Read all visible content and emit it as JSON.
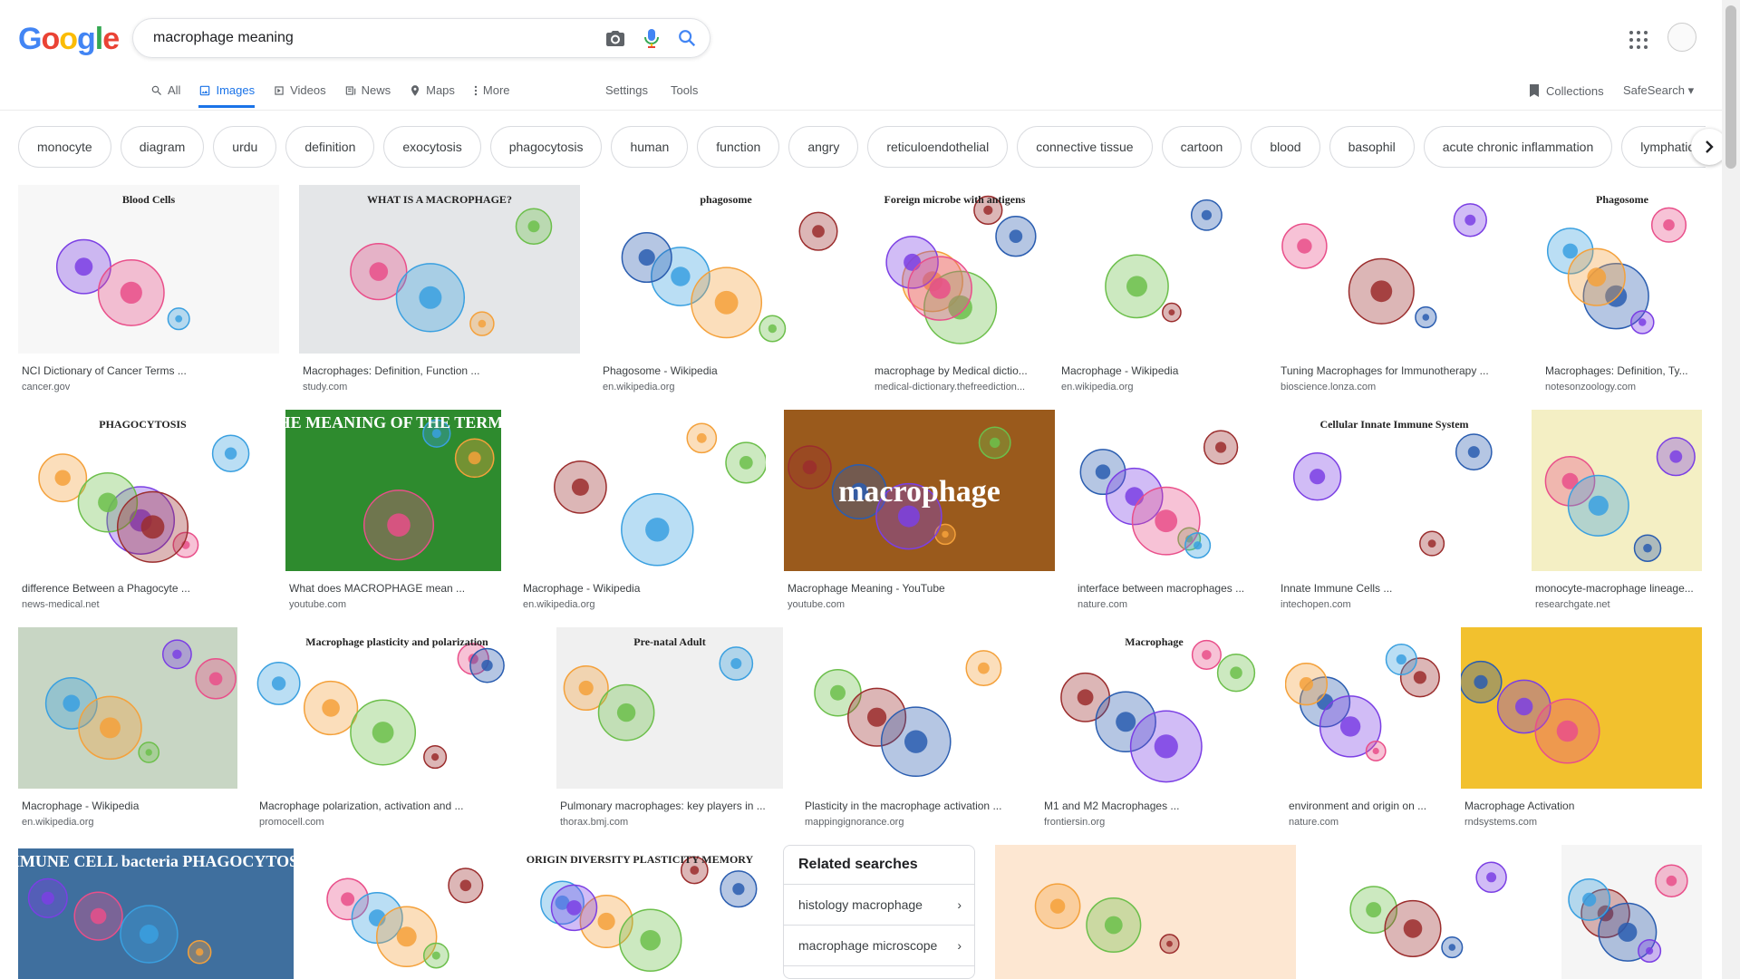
{
  "logo": [
    "G",
    "o",
    "o",
    "g",
    "l",
    "e"
  ],
  "search": {
    "query": "macrophage meaning"
  },
  "tabs": [
    {
      "label": "All",
      "icon": "search-icon"
    },
    {
      "label": "Images",
      "icon": "image-icon",
      "active": true
    },
    {
      "label": "Videos",
      "icon": "video-icon"
    },
    {
      "label": "News",
      "icon": "news-icon"
    },
    {
      "label": "Maps",
      "icon": "map-icon"
    },
    {
      "label": "More",
      "icon": "more-vert-icon"
    }
  ],
  "toolbar": {
    "settings": "Settings",
    "tools": "Tools",
    "collections": "Collections",
    "safesearch": "SafeSearch"
  },
  "chips": [
    "monocyte",
    "diagram",
    "urdu",
    "definition",
    "exocytosis",
    "phagocytosis",
    "human",
    "function",
    "angry",
    "reticuloendothelial",
    "connective tissue",
    "cartoon",
    "blood",
    "basophil",
    "acute chronic inflammation",
    "lymphatic sys"
  ],
  "results": [
    {
      "title": "NCI Dictionary of Cancer Terms ...",
      "source": "cancer.gov",
      "thumb_text": "Blood Cells",
      "color": "#f7f7f7"
    },
    {
      "title": "Macrophages: Definition, Function ...",
      "source": "study.com",
      "thumb_text": "WHAT IS A MACROPHAGE?",
      "color": "#e4e6e8"
    },
    {
      "title": "Phagosome - Wikipedia",
      "source": "en.wikipedia.org",
      "thumb_text": "phagosome",
      "color": "#ffffff"
    },
    {
      "title": "macrophage by Medical dictio...",
      "source": "medical-dictionary.thefreediction...",
      "thumb_text": "Foreign microbe with antigens",
      "color": "#ffffff"
    },
    {
      "title": "Macrophage - Wikipedia",
      "source": "en.wikipedia.org",
      "thumb_text": "",
      "color": "#ffffff"
    },
    {
      "title": "Tuning Macrophages for Immunotherapy ...",
      "source": "bioscience.lonza.com",
      "thumb_text": "",
      "color": "#ffffff"
    },
    {
      "title": "Macrophages: Definition, Ty...",
      "source": "notesonzoology.com",
      "thumb_text": "Phagosome",
      "color": "#ffffff"
    },
    {
      "title": "difference Between a Phagocyte ...",
      "source": "news-medical.net",
      "thumb_text": "PHAGOCYTOSIS",
      "color": "#ffffff"
    },
    {
      "title": "What does MACROPHAGE mean ...",
      "source": "youtube.com",
      "thumb_text": "WHAT IS THE MEANING OF THE TERM macrophage",
      "color": "#2e8b2e"
    },
    {
      "title": "Macrophage - Wikipedia",
      "source": "en.wikipedia.org",
      "thumb_text": "",
      "color": "#ffffff"
    },
    {
      "title": "Macrophage Meaning - YouTube",
      "source": "youtube.com",
      "thumb_text": "macrophage",
      "color": "#9a5a1c"
    },
    {
      "title": "interface between macrophages ...",
      "source": "nature.com",
      "thumb_text": "",
      "color": "#ffffff"
    },
    {
      "title": "Innate Immune Cells ...",
      "source": "intechopen.com",
      "thumb_text": "Cellular Innate Immune System",
      "color": "#ffffff"
    },
    {
      "title": "monocyte-macrophage lineage...",
      "source": "researchgate.net",
      "thumb_text": "",
      "color": "#f4efc4"
    },
    {
      "title": "Macrophage - Wikipedia",
      "source": "en.wikipedia.org",
      "thumb_text": "",
      "color": "#c8d6c4"
    },
    {
      "title": "Macrophage polarization, activation and ...",
      "source": "promocell.com",
      "thumb_text": "Macrophage plasticity and polarization",
      "color": "#ffffff"
    },
    {
      "title": "Pulmonary macrophages: key players in ...",
      "source": "thorax.bmj.com",
      "thumb_text": "Pre-natal   Adult",
      "color": "#f0f0f0"
    },
    {
      "title": "Plasticity in the macrophage activation ...",
      "source": "mappingignorance.org",
      "thumb_text": "",
      "color": "#ffffff"
    },
    {
      "title": "M1 and M2 Macrophages ...",
      "source": "frontiersin.org",
      "thumb_text": "Macrophage",
      "color": "#ffffff"
    },
    {
      "title": "environment and origin on ...",
      "source": "nature.com",
      "thumb_text": "",
      "color": "#ffffff"
    },
    {
      "title": "Macrophage Activation",
      "source": "rndsystems.com",
      "thumb_text": "",
      "color": "#f2c12e"
    },
    {
      "title": "",
      "source": "",
      "thumb_text": "IMMUNE CELL  bacteria  PHAGOCYTOSIS",
      "color": "#3f6f9e"
    },
    {
      "title": "",
      "source": "",
      "thumb_text": "",
      "color": "#ffffff"
    },
    {
      "title": "",
      "source": "",
      "thumb_text": "ORIGIN  DIVERSITY  PLASTICITY  MEMORY",
      "color": "#ffffff"
    },
    {
      "title": "",
      "source": "",
      "thumb_text": "",
      "color": "#fde7d2"
    },
    {
      "title": "",
      "source": "",
      "thumb_text": "",
      "color": "#ffffff"
    },
    {
      "title": "",
      "source": "",
      "thumb_text": "",
      "color": "#f5f5f5"
    }
  ],
  "related": {
    "heading": "Related searches",
    "items": [
      "histology macrophage",
      "macrophage microscope"
    ]
  }
}
